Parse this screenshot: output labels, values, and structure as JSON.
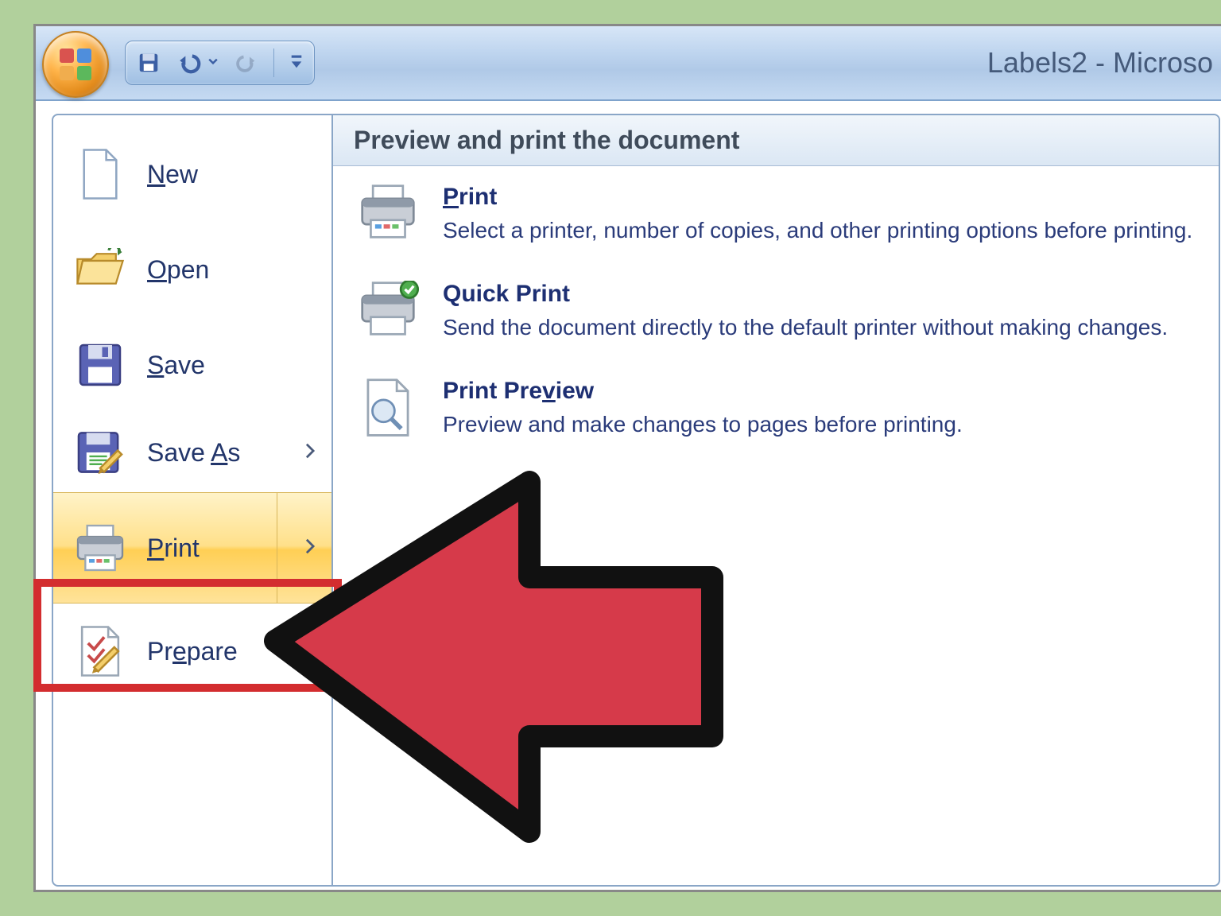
{
  "titlebar": {
    "window_title": "Labels2 - Microso"
  },
  "left_menu": {
    "new": {
      "pre": "",
      "accel": "N",
      "post": "ew"
    },
    "open": {
      "pre": "",
      "accel": "O",
      "post": "pen"
    },
    "save": {
      "pre": "",
      "accel": "S",
      "post": "ave"
    },
    "save_as": {
      "pre": "Save ",
      "accel": "A",
      "post": "s"
    },
    "print": {
      "pre": "",
      "accel": "P",
      "post": "rint"
    },
    "prepare": {
      "pre": "Pr",
      "accel": "e",
      "post": "pare"
    }
  },
  "submenu": {
    "header": "Preview and print the document",
    "print": {
      "pre": "",
      "accel": "P",
      "post": "rint",
      "desc": "Select a printer, number of copies, and other printing options before printing."
    },
    "quick_print": {
      "title": "Quick Print",
      "desc": "Send the document directly to the default printer without making changes."
    },
    "preview": {
      "pre": "Print Pre",
      "accel": "v",
      "post": "iew",
      "desc": "Preview and make changes to pages before printing."
    }
  }
}
